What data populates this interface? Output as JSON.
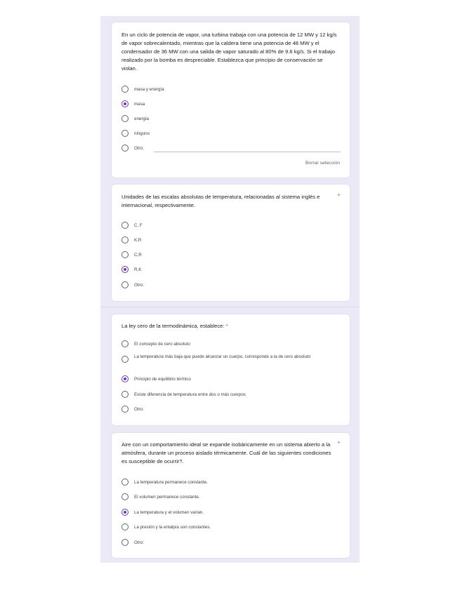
{
  "questions": [
    {
      "title": "En un ciclo de potencia de vapor, una turbina trabaja con una potencia de 12 MW y 12 kg/s de vapor sobrecalentado, mientras que la caldera tiene una potencia de 48 MW y el condensador de 36 MW con una salida de vapor saturado al 80% de 9.6 kg/s. Si el trabajo realizado por la bomba es despreciable. Establezca que principio de conservación se violan.",
      "required": false,
      "options": [
        {
          "label": "masa y energía",
          "selected": false
        },
        {
          "label": "masa",
          "selected": true
        },
        {
          "label": "energía",
          "selected": false
        },
        {
          "label": "ninguno",
          "selected": false
        },
        {
          "label": "Otro:",
          "selected": false
        }
      ],
      "clear_label": "Borrar selección"
    },
    {
      "title": "Unidades de las escalas absolutas de temperatura, relacionadas al sistema inglés e internacional, respectivamente.",
      "required": true,
      "required_mark": "*",
      "options": [
        {
          "label": "C, F",
          "selected": false
        },
        {
          "label": "K,R",
          "selected": false
        },
        {
          "label": "C,R",
          "selected": false
        },
        {
          "label": "R,K",
          "selected": true
        },
        {
          "label": "Otro:",
          "selected": false
        }
      ]
    },
    {
      "title": "La ley cero de la termodinámica, establece:",
      "required_mark": "*",
      "options": [
        {
          "label": "El concepto de cero absoluto",
          "selected": false
        },
        {
          "label": "La temperatura más baja que puede alcanzar un cuerpo, corresponde a la de cero absoluto",
          "selected": false
        },
        {
          "label": "Principio de equilibrio térmico",
          "selected": true
        },
        {
          "label": "Existe diferencia de temperatura entre dos o más cuerpos",
          "selected": false
        },
        {
          "label": "Otro:",
          "selected": false
        }
      ]
    },
    {
      "title": "Aire con un comportamiento ideal se expande isobáricamente en un sistema abierto a la atmósfera, durante un proceso aislado térmicamente. Cuál de las siguientes condiciones es susceptible de ocurrir?.",
      "required": true,
      "required_mark": "*",
      "options": [
        {
          "label": "La temperatura permanece constante.",
          "selected": false
        },
        {
          "label": "El volumen permanece constante.",
          "selected": false
        },
        {
          "label": "La temperatura y el volumen varían.",
          "selected": true
        },
        {
          "label": "La presión y la entalpía son constantes.",
          "selected": false
        },
        {
          "label": "Otro:",
          "selected": false
        }
      ]
    }
  ],
  "colors": {
    "accent": "#673ab7",
    "required": "#d93025",
    "background": "#ece9f6"
  }
}
